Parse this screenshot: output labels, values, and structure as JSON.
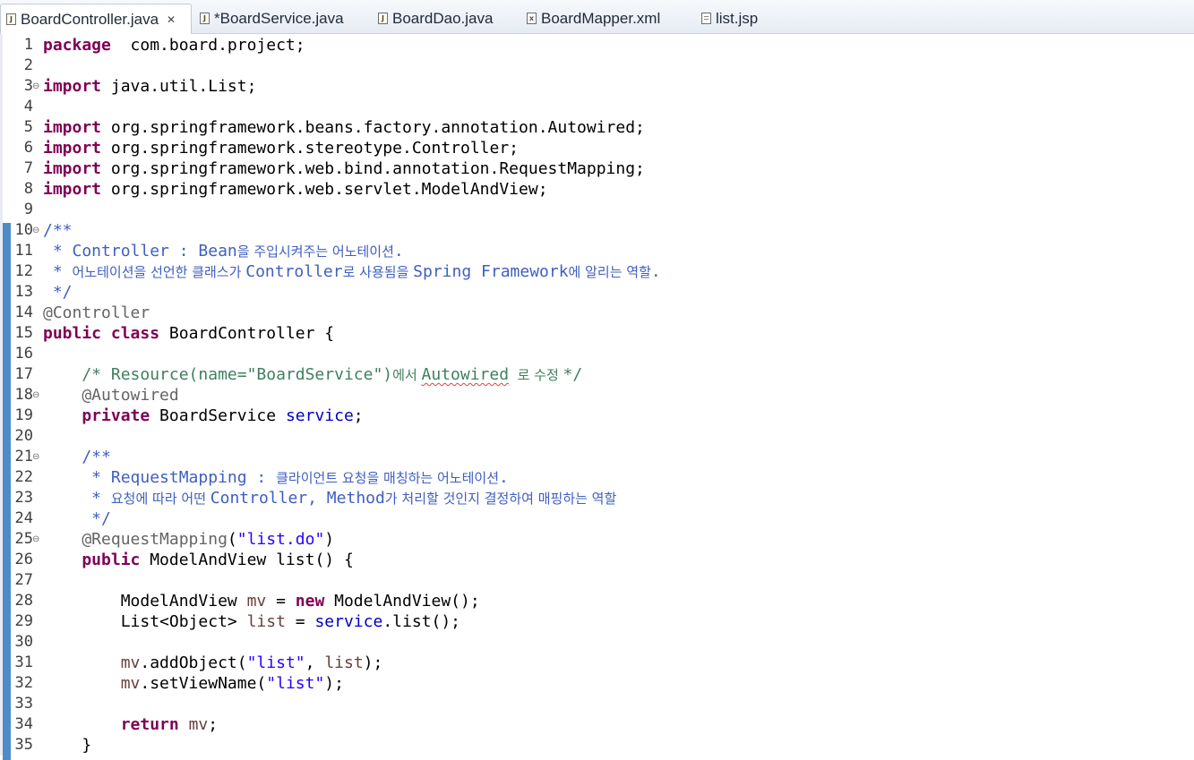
{
  "tabs": [
    {
      "label": "BoardController.java",
      "icon": "java-file-icon",
      "active": true,
      "close": "✕"
    },
    {
      "label": "*BoardService.java",
      "icon": "java-file-icon",
      "active": false
    },
    {
      "label": "BoardDao.java",
      "icon": "java-file-icon",
      "active": false
    },
    {
      "label": "BoardMapper.xml",
      "icon": "xml-file-icon",
      "active": false
    },
    {
      "label": "list.jsp",
      "icon": "jsp-file-icon",
      "active": false
    }
  ],
  "colors": {
    "keyword": "#7f0055",
    "comment": "#3f7f5f",
    "javadoc": "#3f5fbf",
    "annotation": "#646464",
    "field": "#0000c0",
    "local_var": "#6a3e3e",
    "string": "#2a00ff",
    "change_bar": "#4f8bc9"
  },
  "lines": [
    {
      "n": "1",
      "fold": false,
      "tokens": [
        [
          "kw",
          "package"
        ],
        [
          "",
          "  com.board.project;"
        ]
      ]
    },
    {
      "n": "2",
      "fold": false,
      "tokens": []
    },
    {
      "n": "3",
      "fold": true,
      "tokens": [
        [
          "kw",
          "import"
        ],
        [
          "",
          " java.util.List;"
        ]
      ]
    },
    {
      "n": "4",
      "fold": false,
      "tokens": []
    },
    {
      "n": "5",
      "fold": false,
      "tokens": [
        [
          "kw",
          "import"
        ],
        [
          "",
          " org.springframework.beans.factory.annotation.Autowired;"
        ]
      ]
    },
    {
      "n": "6",
      "fold": false,
      "tokens": [
        [
          "kw",
          "import"
        ],
        [
          "",
          " org.springframework.stereotype.Controller;"
        ]
      ]
    },
    {
      "n": "7",
      "fold": false,
      "tokens": [
        [
          "kw",
          "import"
        ],
        [
          "",
          " org.springframework.web.bind.annotation.RequestMapping;"
        ]
      ]
    },
    {
      "n": "8",
      "fold": false,
      "tokens": [
        [
          "kw",
          "import"
        ],
        [
          "",
          " org.springframework.web.servlet.ModelAndView;"
        ]
      ]
    },
    {
      "n": "9",
      "fold": false,
      "tokens": []
    },
    {
      "n": "10",
      "fold": true,
      "tokens": [
        [
          "jd",
          "/**"
        ]
      ]
    },
    {
      "n": "11",
      "fold": false,
      "tokens": [
        [
          "jd",
          " * Controller : Bean"
        ],
        [
          "jd ko",
          "을 주입시켜주는 어노테이션"
        ],
        [
          "jd",
          "."
        ]
      ]
    },
    {
      "n": "12",
      "fold": false,
      "tokens": [
        [
          "jd",
          " * "
        ],
        [
          "jd ko",
          "어노테이션을 선언한 클래스가 "
        ],
        [
          "jd",
          "Controller"
        ],
        [
          "jd ko",
          "로 사용됨을 "
        ],
        [
          "jd",
          "Spring Framework"
        ],
        [
          "jd ko",
          "에 알리는 역할"
        ],
        [
          "jd",
          "."
        ]
      ]
    },
    {
      "n": "13",
      "fold": false,
      "tokens": [
        [
          "jd",
          " */"
        ]
      ]
    },
    {
      "n": "14",
      "fold": false,
      "tokens": [
        [
          "an",
          "@Controller"
        ]
      ]
    },
    {
      "n": "15",
      "fold": false,
      "tokens": [
        [
          "kw",
          "public"
        ],
        [
          "",
          " "
        ],
        [
          "kw",
          "class"
        ],
        [
          "",
          " BoardController {"
        ]
      ]
    },
    {
      "n": "16",
      "fold": false,
      "tokens": []
    },
    {
      "n": "17",
      "fold": false,
      "tokens": [
        [
          "cm",
          "    /* Resource(name=\"BoardService\")"
        ],
        [
          "cm ko",
          "에서 "
        ],
        [
          "cm squig",
          "Autowired"
        ],
        [
          "cm ko",
          "  로 수정 "
        ],
        [
          "cm",
          "*/"
        ]
      ]
    },
    {
      "n": "18",
      "fold": true,
      "tokens": [
        [
          "an",
          "    @Autowired"
        ]
      ]
    },
    {
      "n": "19",
      "fold": false,
      "tokens": [
        [
          "kw",
          "    private"
        ],
        [
          "",
          " BoardService "
        ],
        [
          "fd",
          "service"
        ],
        [
          "",
          ";"
        ]
      ]
    },
    {
      "n": "20",
      "fold": false,
      "tokens": []
    },
    {
      "n": "21",
      "fold": true,
      "tokens": [
        [
          "jd",
          "    /**"
        ]
      ]
    },
    {
      "n": "22",
      "fold": false,
      "tokens": [
        [
          "jd",
          "     * RequestMapping : "
        ],
        [
          "jd ko",
          "클라이언트 요청을 매칭하는 어노테이션"
        ],
        [
          "jd",
          "."
        ]
      ]
    },
    {
      "n": "23",
      "fold": false,
      "tokens": [
        [
          "jd",
          "     * "
        ],
        [
          "jd ko",
          "요청에 따라 어떤 "
        ],
        [
          "jd",
          "Controller, Method"
        ],
        [
          "jd ko",
          "가 처리할 것인지 결정하여 매핑하는 역할"
        ]
      ]
    },
    {
      "n": "24",
      "fold": false,
      "tokens": [
        [
          "jd",
          "     */"
        ]
      ]
    },
    {
      "n": "25",
      "fold": true,
      "tokens": [
        [
          "an",
          "    @RequestMapping"
        ],
        [
          "",
          "("
        ],
        [
          "st",
          "\"list.do\""
        ],
        [
          "",
          ")"
        ]
      ]
    },
    {
      "n": "26",
      "fold": false,
      "tokens": [
        [
          "kw",
          "    public"
        ],
        [
          "",
          " ModelAndView list() {"
        ]
      ]
    },
    {
      "n": "27",
      "fold": false,
      "tokens": []
    },
    {
      "n": "28",
      "fold": false,
      "tokens": [
        [
          "",
          "        ModelAndView "
        ],
        [
          "lv",
          "mv"
        ],
        [
          "",
          " = "
        ],
        [
          "kw",
          "new"
        ],
        [
          "",
          " ModelAndView();"
        ]
      ]
    },
    {
      "n": "29",
      "fold": false,
      "tokens": [
        [
          "",
          "        List<Object> "
        ],
        [
          "lv",
          "list"
        ],
        [
          "",
          " = "
        ],
        [
          "fd",
          "service"
        ],
        [
          "",
          ".list();"
        ]
      ]
    },
    {
      "n": "30",
      "fold": false,
      "tokens": []
    },
    {
      "n": "31",
      "fold": false,
      "tokens": [
        [
          "lv",
          "        mv"
        ],
        [
          "",
          ".addObject("
        ],
        [
          "st",
          "\"list\""
        ],
        [
          "",
          ", "
        ],
        [
          "lv",
          "list"
        ],
        [
          "",
          ");"
        ]
      ]
    },
    {
      "n": "32",
      "fold": false,
      "tokens": [
        [
          "lv",
          "        mv"
        ],
        [
          "",
          ".setViewName("
        ],
        [
          "st",
          "\"list\""
        ],
        [
          "",
          ");"
        ]
      ]
    },
    {
      "n": "33",
      "fold": false,
      "tokens": []
    },
    {
      "n": "34",
      "fold": false,
      "tokens": [
        [
          "kw",
          "        return"
        ],
        [
          "",
          " "
        ],
        [
          "lv",
          "mv"
        ],
        [
          "",
          ";"
        ]
      ]
    },
    {
      "n": "35",
      "fold": false,
      "tokens": [
        [
          "",
          "    }"
        ]
      ]
    }
  ]
}
